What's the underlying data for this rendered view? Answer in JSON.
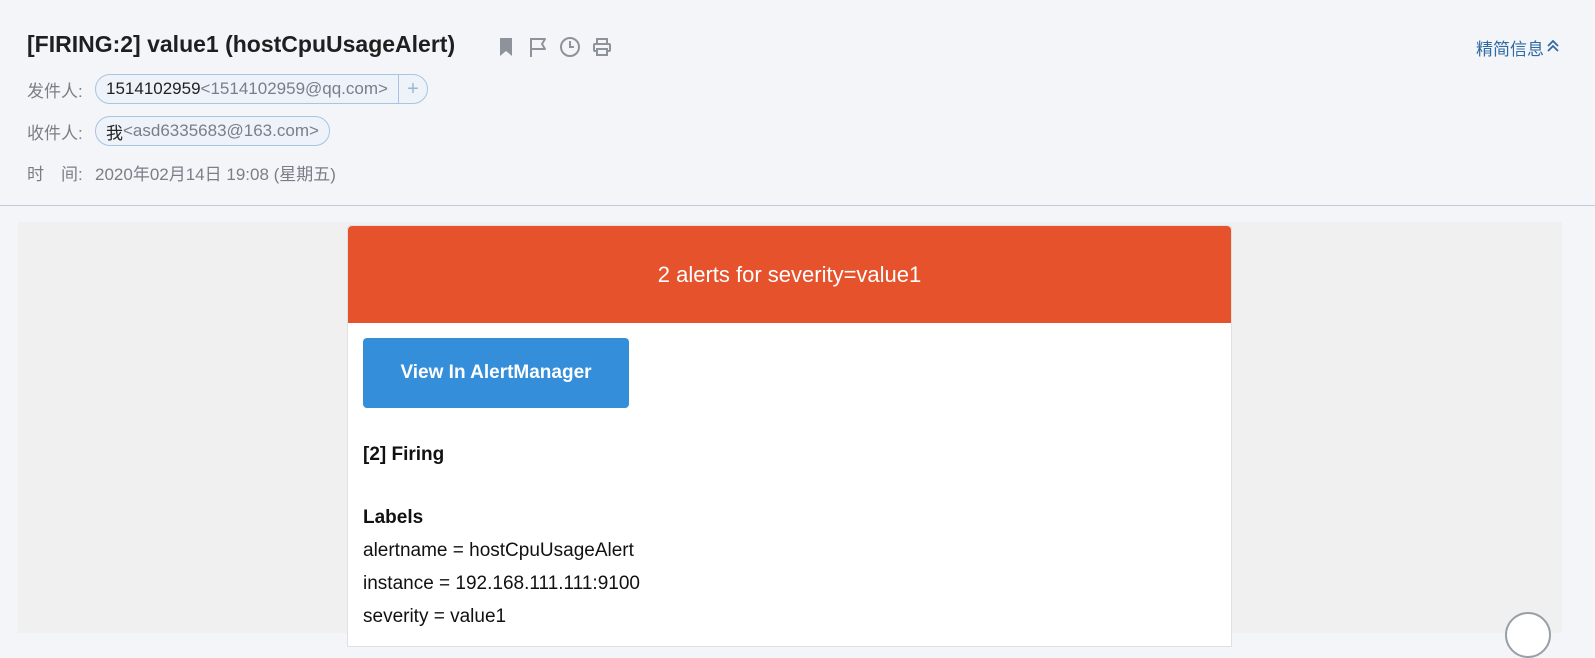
{
  "mail": {
    "subject": "[FIRING:2] value1 (hostCpuUsageAlert)",
    "concise_toggle": "精简信息",
    "sender_label": "发件人:",
    "sender_name": "1514102959",
    "sender_address": "<1514102959@qq.com>",
    "add_contact": "+",
    "recipient_label": "收件人:",
    "recipient_name": "我",
    "recipient_address": "<asd6335683@163.com>",
    "time_label": "时　间:",
    "time_value": "2020年02月14日 19:08 (星期五)",
    "icons": [
      "bookmark-icon",
      "flag-icon",
      "clock-icon",
      "print-icon"
    ]
  },
  "alert": {
    "header": "2 alerts for severity=value1",
    "header_color": "#e6522c",
    "button_label": "View In AlertManager",
    "button_color": "#348eda",
    "firing_title": "[2] Firing",
    "labels_title": "Labels",
    "labels": [
      "alertname = hostCpuUsageAlert",
      "instance = 192.168.111.111:9100",
      "severity = value1"
    ]
  },
  "colors": {
    "link": "#2f6aa3",
    "chip_border": "#a9c4e0"
  }
}
